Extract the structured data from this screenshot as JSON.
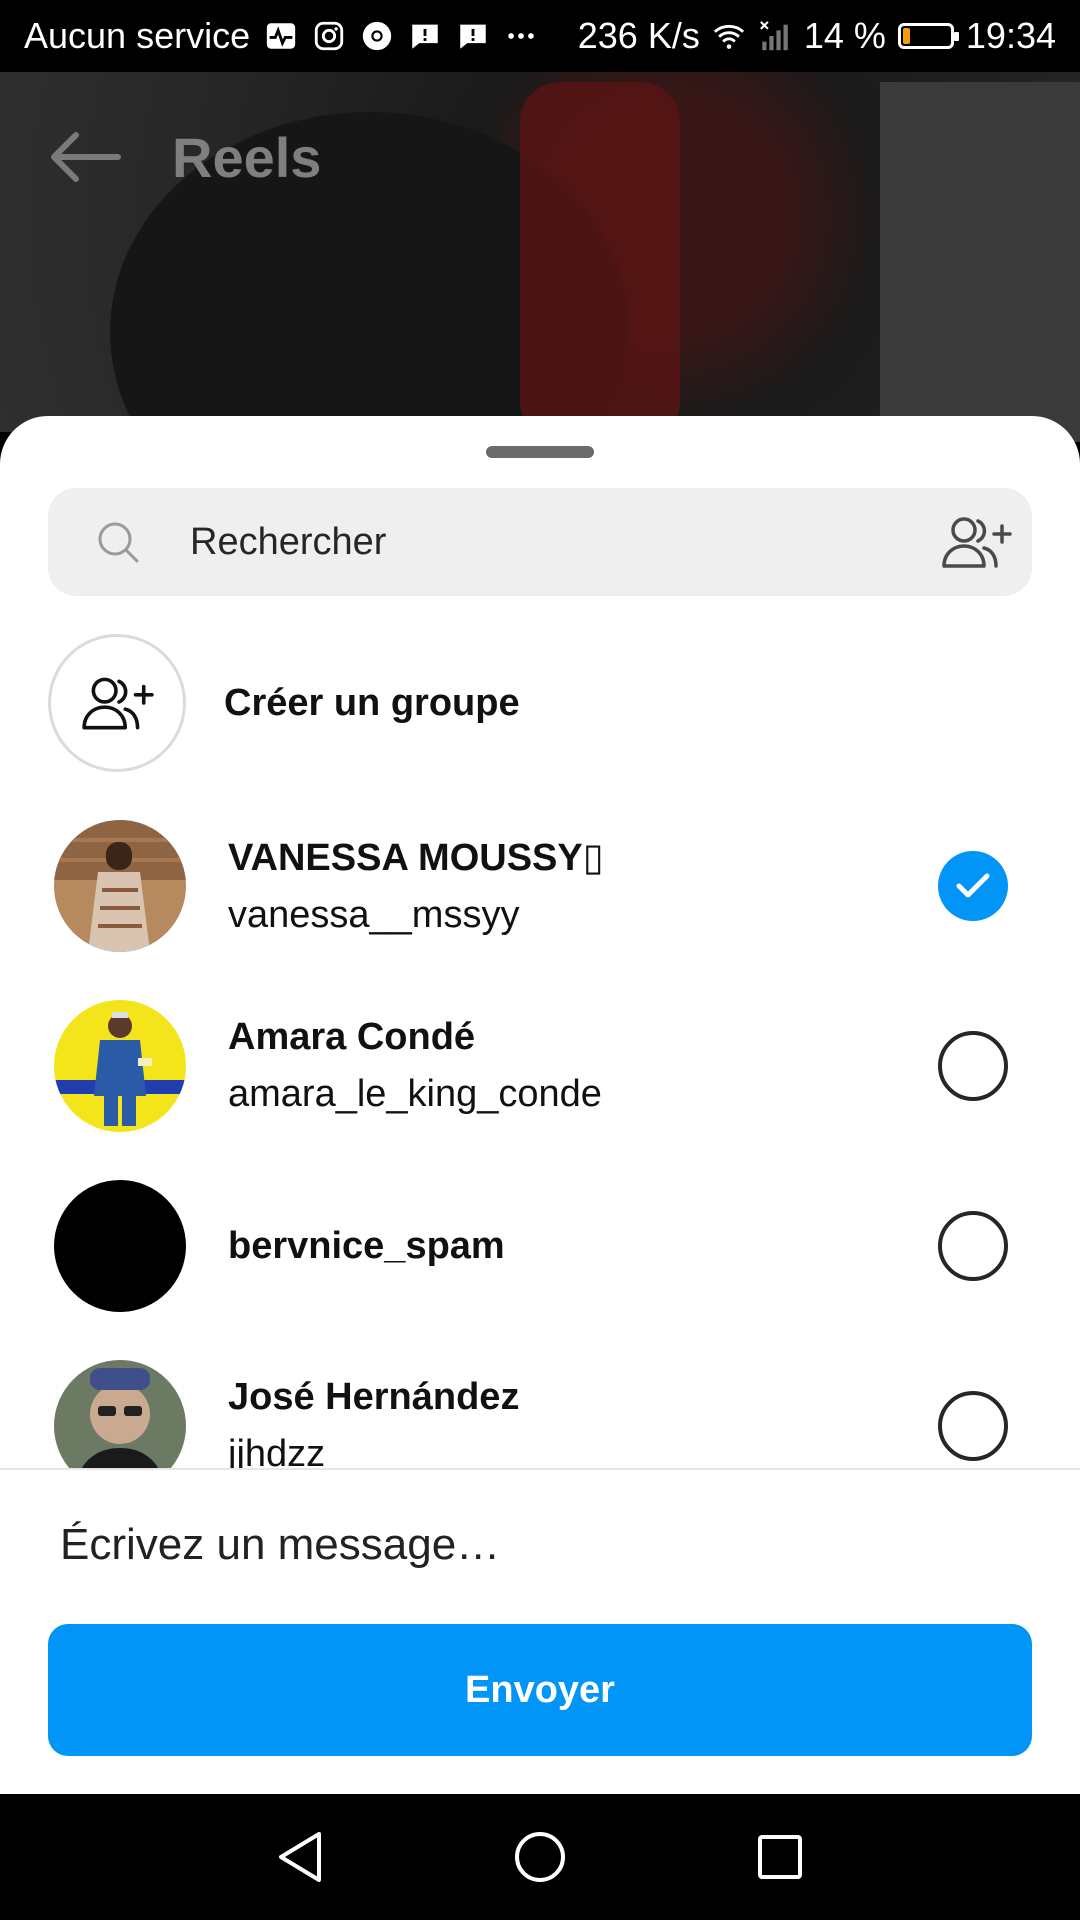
{
  "status_bar": {
    "carrier": "Aucun service",
    "speed": "236 K/s",
    "battery_percent": "14 %",
    "battery_level": 0.14,
    "time": "19:34",
    "icons": [
      "activity-icon",
      "instagram-icon",
      "chrome-icon",
      "message-alert-icon",
      "message-alert-icon",
      "more-icon",
      "wifi-icon",
      "signal-icon",
      "battery-icon",
      "leaf-icon"
    ]
  },
  "header": {
    "title": "Reels",
    "back_icon": "arrow-left-icon"
  },
  "sheet": {
    "search": {
      "placeholder": "Rechercher",
      "search_icon": "search-icon",
      "add_user_icon": "add-users-icon"
    },
    "create_group": {
      "label": "Créer un groupe",
      "icon": "add-users-icon"
    },
    "contacts": [
      {
        "name": "VANESSA MOUSSY▯",
        "username": "vanessa__mssyy",
        "selected": true
      },
      {
        "name": "Amara Condé",
        "username": "amara_le_king_conde",
        "selected": false
      },
      {
        "name": "bervnice_spam",
        "username": "",
        "selected": false
      },
      {
        "name": "José Hernández",
        "username": "jjhdzz",
        "selected": false
      }
    ],
    "message_placeholder": "Écrivez un message…",
    "send_label": "Envoyer"
  },
  "colors": {
    "accent": "#0095f6",
    "search_bg": "#efefef",
    "sheet_bg": "#ffffff"
  },
  "nav_bar": {
    "buttons": [
      "back-triangle-icon",
      "home-circle-icon",
      "recents-square-icon"
    ]
  }
}
